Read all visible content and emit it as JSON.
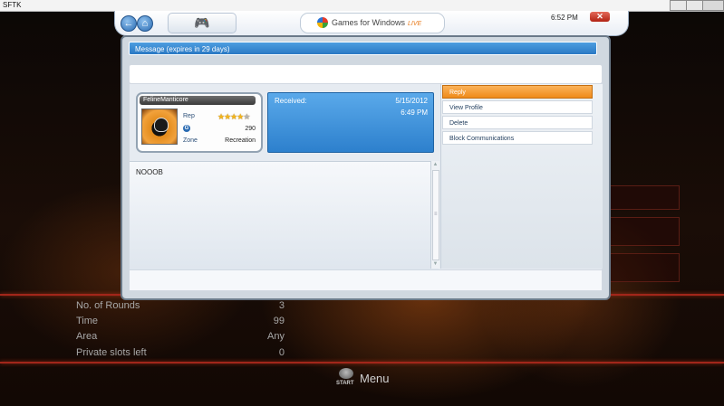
{
  "app_window": {
    "title": "SFTK"
  },
  "gfwl": {
    "brand_text": "Games for Windows",
    "brand_live": "LIVE",
    "clock": "6:52 PM",
    "message_header": "Message (expires in 29 days)"
  },
  "gamercard": {
    "gamertag": "FelineManticore",
    "rep_label": "Rep",
    "rep_stars": 4,
    "rep_stars_max": 5,
    "gamerscore": "290",
    "zone_label": "Zone",
    "zone": "Recreation"
  },
  "received": {
    "label": "Received:",
    "date": "5/15/2012",
    "time": "6:49 PM"
  },
  "message": {
    "body": "NOOOB"
  },
  "actions": [
    {
      "label": "Reply",
      "active": true
    },
    {
      "label": "View Profile",
      "active": false
    },
    {
      "label": "Delete",
      "active": false
    },
    {
      "label": "Block Communications",
      "active": false
    }
  ],
  "game_settings": [
    {
      "label": "No. of Rounds",
      "value": "3"
    },
    {
      "label": "Time",
      "value": "99"
    },
    {
      "label": "Area",
      "value": "Any"
    },
    {
      "label": "Private slots left",
      "value": "0"
    }
  ],
  "footer": {
    "start_label": "START",
    "menu_label": "Menu"
  },
  "colors": {
    "accent_blue": "#2a79c4",
    "selected_orange": "#ef8a1a",
    "game_red": "#a2261a"
  }
}
